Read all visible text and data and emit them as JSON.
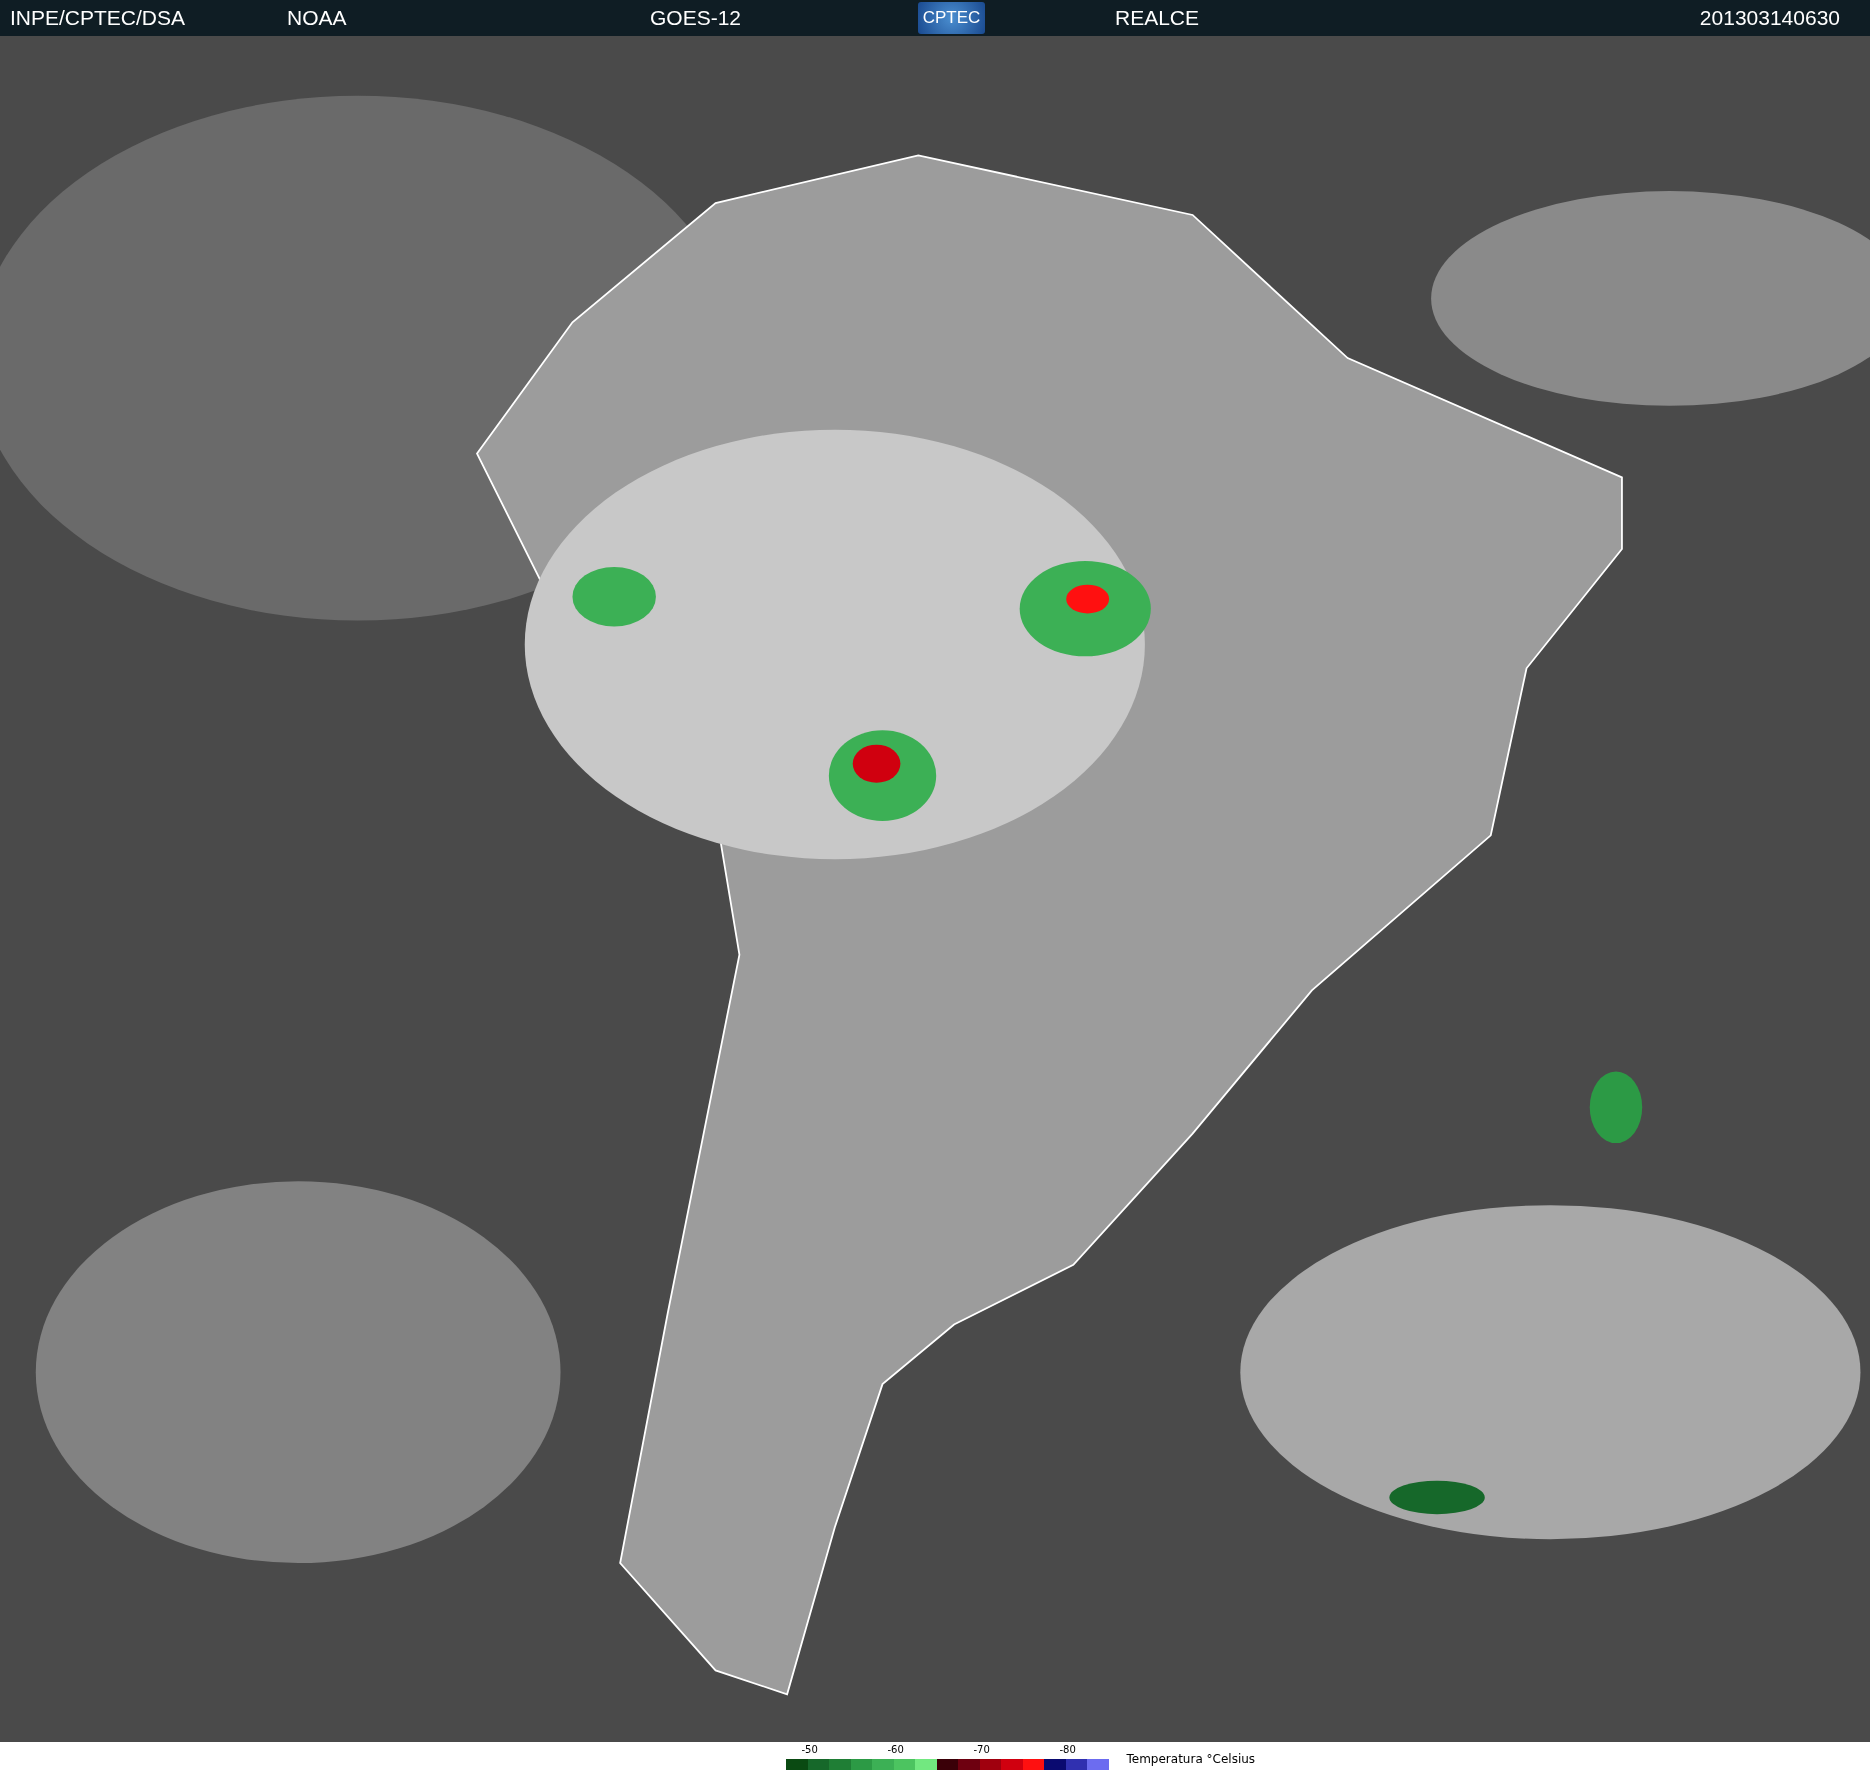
{
  "header": {
    "source": "INPE/CPTEC/DSA",
    "agency": "NOAA",
    "satellite": "GOES-12",
    "logo_text": "CPTEC",
    "product": "REALCE",
    "timestamp": "201303140630"
  },
  "legend": {
    "title": "Temperatura °Celsius",
    "swatches": [
      {
        "color": "#0a4a12"
      },
      {
        "color": "#16682a",
        "tick": "-50"
      },
      {
        "color": "#1f7e35"
      },
      {
        "color": "#2c9a45"
      },
      {
        "color": "#3cb055"
      },
      {
        "color": "#4cc460",
        "tick": "-60"
      },
      {
        "color": "#72e880"
      },
      {
        "color": "#3a0008"
      },
      {
        "color": "#6e0010"
      },
      {
        "color": "#a0000e",
        "tick": "-70"
      },
      {
        "color": "#d0000f"
      },
      {
        "color": "#ff1010"
      },
      {
        "color": "#0a0a70"
      },
      {
        "color": "#3030b0",
        "tick": "-80"
      },
      {
        "color": "#6c6cf0"
      }
    ]
  }
}
